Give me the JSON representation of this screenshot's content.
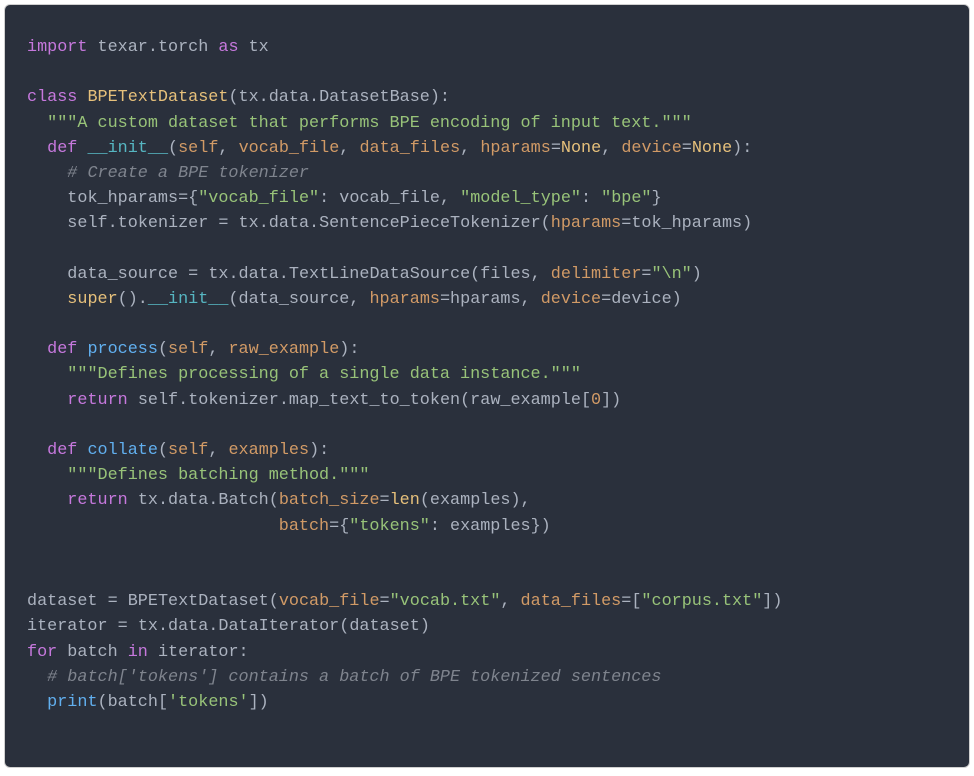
{
  "code": {
    "l01": {
      "import": "import",
      "module": "texar.torch",
      "as": "as",
      "alias": "tx"
    },
    "l02": {
      "blank": ""
    },
    "l03": {
      "class_kw": "class",
      "class_name": "BPETextDataset",
      "base": "tx.data.DatasetBase"
    },
    "l04": {
      "docstring": "\"\"\"A custom dataset that performs BPE encoding of input text.\"\"\""
    },
    "l05": {
      "def_kw": "def",
      "func": "__init__",
      "params_a": "self",
      "params_b": "vocab_file",
      "params_c": "data_files",
      "kw1": "hparams",
      "none1": "None",
      "kw2": "device",
      "none2": "None"
    },
    "l06": {
      "comment": "# Create a BPE tokenizer"
    },
    "l07": {
      "var": "tok_hparams",
      "key1": "\"vocab_file\"",
      "val1": "vocab_file",
      "key2": "\"model_type\"",
      "val2": "\"bpe\""
    },
    "l08": {
      "self": "self",
      "attr": "tokenizer",
      "path": "tx.data.SentencePieceTokenizer",
      "kw": "hparams",
      "arg": "tok_hparams"
    },
    "l09": {
      "blank": ""
    },
    "l10": {
      "var": "data_source",
      "path": "tx.data.TextLineDataSource",
      "arg1": "files",
      "kw": "delimiter",
      "val": "\"\\n\""
    },
    "l11": {
      "super": "super",
      "init": "__init__",
      "arg1": "data_source",
      "kw1": "hparams",
      "v1": "hparams",
      "kw2": "device",
      "v2": "device"
    },
    "l12": {
      "blank": ""
    },
    "l13": {
      "def_kw": "def",
      "func": "process",
      "p1": "self",
      "p2": "raw_example"
    },
    "l14": {
      "docstring": "\"\"\"Defines processing of a single data instance.\"\"\""
    },
    "l15": {
      "ret": "return",
      "self": "self",
      "attr": "tokenizer.map_text_to_token",
      "arg": "raw_example",
      "idx": "0"
    },
    "l16": {
      "blank": ""
    },
    "l17": {
      "def_kw": "def",
      "func": "collate",
      "p1": "self",
      "p2": "examples"
    },
    "l18": {
      "docstring": "\"\"\"Defines batching method.\"\"\""
    },
    "l19": {
      "ret": "return",
      "path": "tx.data.Batch",
      "kw": "batch_size",
      "len": "len",
      "arg": "examples"
    },
    "l20": {
      "kw": "batch",
      "key": "\"tokens\"",
      "val": "examples"
    },
    "l21": {
      "blank": ""
    },
    "l22": {
      "blank": ""
    },
    "l23": {
      "var": "dataset",
      "cls": "BPETextDataset",
      "kw1": "vocab_file",
      "v1": "\"vocab.txt\"",
      "kw2": "data_files",
      "v2": "\"corpus.txt\""
    },
    "l24": {
      "var": "iterator",
      "path": "tx.data.DataIterator",
      "arg": "dataset"
    },
    "l25": {
      "for": "for",
      "var": "batch",
      "in": "in",
      "it": "iterator"
    },
    "l26": {
      "comment": "# batch['tokens'] contains a batch of BPE tokenized sentences"
    },
    "l27": {
      "print": "print",
      "var": "batch",
      "key": "'tokens'"
    }
  }
}
